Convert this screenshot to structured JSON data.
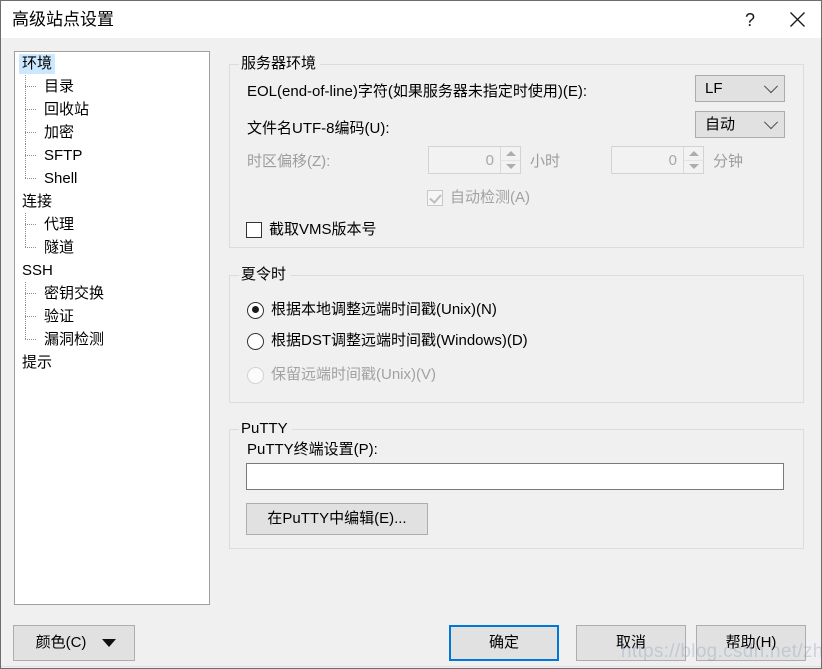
{
  "window": {
    "title": "高级站点设置",
    "help_button": "?",
    "close_button": "✕"
  },
  "sidebar": {
    "items": [
      {
        "label": "环境",
        "level": 0,
        "selected": true,
        "last": false
      },
      {
        "label": "目录",
        "level": 1,
        "selected": false,
        "last": false
      },
      {
        "label": "回收站",
        "level": 1,
        "selected": false,
        "last": false
      },
      {
        "label": "加密",
        "level": 1,
        "selected": false,
        "last": false
      },
      {
        "label": "SFTP",
        "level": 1,
        "selected": false,
        "last": false
      },
      {
        "label": "Shell",
        "level": 1,
        "selected": false,
        "last": true
      },
      {
        "label": "连接",
        "level": 0,
        "selected": false,
        "last": false
      },
      {
        "label": "代理",
        "level": 1,
        "selected": false,
        "last": false
      },
      {
        "label": "隧道",
        "level": 1,
        "selected": false,
        "last": true
      },
      {
        "label": "SSH",
        "level": 0,
        "selected": false,
        "last": false
      },
      {
        "label": "密钥交换",
        "level": 1,
        "selected": false,
        "last": false
      },
      {
        "label": "验证",
        "level": 1,
        "selected": false,
        "last": false
      },
      {
        "label": "漏洞检测",
        "level": 1,
        "selected": false,
        "last": true
      },
      {
        "label": "提示",
        "level": 0,
        "selected": false,
        "last": false
      }
    ]
  },
  "server_environment": {
    "caption": "服务器环境",
    "eol_label": "EOL(end-of-line)字符(如果服务器未指定时使用)(E):",
    "eol_value": "LF",
    "utf8_label": "文件名UTF-8编码(U):",
    "utf8_value": "自动",
    "timezone_label": "时区偏移(Z):",
    "hours_value": "0",
    "hours_unit": "小时",
    "minutes_value": "0",
    "minutes_unit": "分钟",
    "autodetect_label": "自动检测(A)",
    "vms_label": "截取VMS版本号"
  },
  "daylight_saving": {
    "caption": "夏令时",
    "options": [
      {
        "label": "根据本地调整远端时间戳(Unix)(N)",
        "checked": true,
        "disabled": false
      },
      {
        "label": "根据DST调整远端时间戳(Windows)(D)",
        "checked": false,
        "disabled": false
      },
      {
        "label": "保留远端时间戳(Unix)(V)",
        "checked": false,
        "disabled": true
      }
    ]
  },
  "putty": {
    "caption": "PuTTY",
    "terminal_label": "PuTTY终端设置(P):",
    "terminal_value": "",
    "terminal_placeholder": "",
    "edit_button": "在PuTTY中编辑(E)..."
  },
  "footer": {
    "color_button": "颜色(C)",
    "ok_button": "确定",
    "cancel_button": "取消",
    "help_button": "帮助(H)"
  },
  "watermark": "https://blog.csdn.net/zhidc",
  "colors": {
    "accent": "#0078D7",
    "dialog_background": "#F0F0F0",
    "selection": "#CCE8FF",
    "disabled_text": "#A2A2A2"
  }
}
